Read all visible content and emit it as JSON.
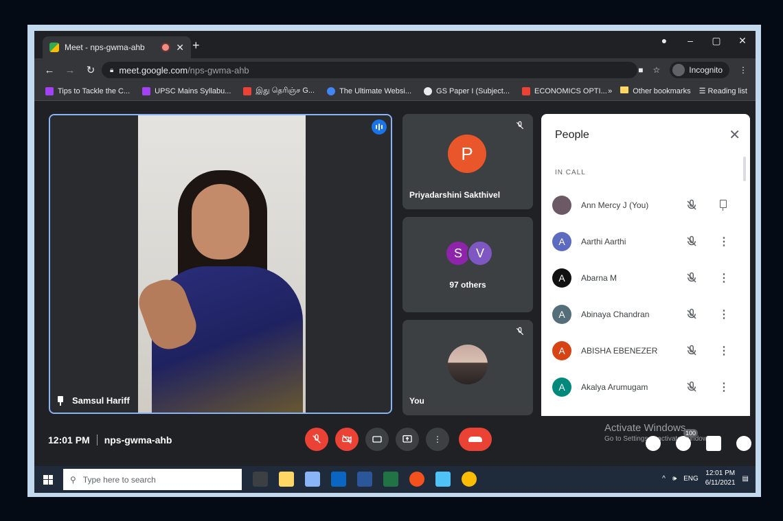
{
  "browser": {
    "tab_title": "Meet - nps-gwma-ahb",
    "new_tab": "+",
    "url_host": "meet.google.com",
    "url_path": "/nps-gwma-ahb",
    "incognito_label": "Incognito",
    "bookmarks": [
      {
        "label": "Tips to Tackle the C...",
        "color": "#a142f4"
      },
      {
        "label": "UPSC Mains Syllabu...",
        "color": "#a142f4"
      },
      {
        "label": "இது தெரிஞ்ச G...",
        "color": "#ea4335"
      },
      {
        "label": "The Ultimate Websi...",
        "color": "#4285f4"
      },
      {
        "label": "GS Paper I (Subject...",
        "color": "#e8eaed"
      },
      {
        "label": "ECONOMICS OPTI...",
        "color": "#ea4335"
      }
    ],
    "more_bookmarks": "»",
    "other_bookmarks": "Other bookmarks",
    "reading_list": "Reading list"
  },
  "meet": {
    "main_speaker": "Samsul Hariff",
    "tiles": [
      {
        "initial": "P",
        "name": "Priyadarshini Sakthivel",
        "color": "#e8562a"
      },
      {
        "initials": [
          "S",
          "V"
        ],
        "caption": "97 others"
      },
      {
        "name": "You"
      }
    ],
    "time": "12:01 PM",
    "meeting_code": "nps-gwma-ahb",
    "participants_badge": "100"
  },
  "people": {
    "title": "People",
    "section": "IN CALL",
    "list": [
      {
        "name": "Ann Mercy J (You)",
        "initial": "",
        "color": "#6b5a66",
        "action": "pin-icon"
      },
      {
        "name": "Aarthi Aarthi",
        "initial": "A",
        "color": "#5c6bc0",
        "action": "more-vert-icon"
      },
      {
        "name": "Abarna M",
        "initial": "A",
        "color": "#111111",
        "action": "more-vert-icon"
      },
      {
        "name": "Abinaya Chandran",
        "initial": "A",
        "color": "#546e7a",
        "action": "more-vert-icon"
      },
      {
        "name": "ABISHA EBENEZER",
        "initial": "A",
        "color": "#d84315",
        "action": "more-vert-icon"
      },
      {
        "name": "Akalya Arumugam",
        "initial": "A",
        "color": "#00897b",
        "action": "more-vert-icon"
      }
    ]
  },
  "watermark": {
    "line1": "Activate Windows",
    "line2": "Go to Settings to activate Windows."
  },
  "taskbar": {
    "search_placeholder": "Type here to search",
    "lang": "ENG",
    "time": "12:01 PM",
    "date": "6/11/2021",
    "tray_arrow": "^",
    "volume": "🕪"
  }
}
